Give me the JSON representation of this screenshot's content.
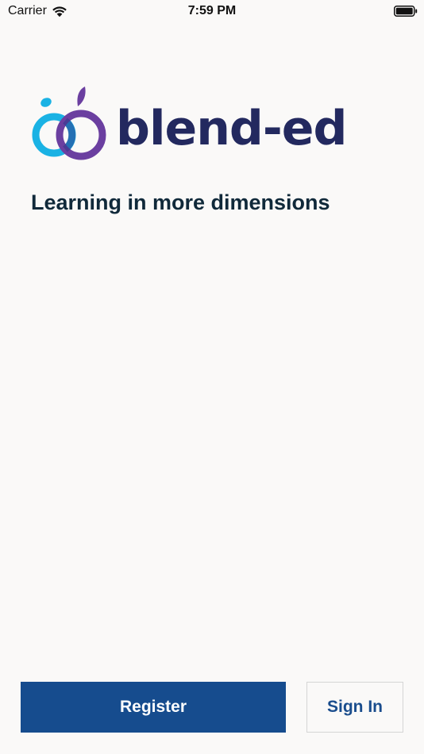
{
  "status_bar": {
    "carrier": "Carrier",
    "time": "7:59 PM",
    "wifi_icon": "wifi-icon",
    "battery_icon": "battery-full-icon"
  },
  "logo": {
    "wordmark": "blend-ed",
    "mark_icon": "two-interlocking-rings-apple-icon",
    "colors": {
      "ring_left": "#1ab2e4",
      "ring_right": "#6b3fa0",
      "wordmark": "#23295f"
    }
  },
  "tagline": "Learning in more dimensions",
  "actions": {
    "register_label": "Register",
    "signin_label": "Sign In"
  },
  "colors": {
    "background": "#faf9f8",
    "primary_button": "#164c8e",
    "secondary_text": "#1a4d8d"
  }
}
